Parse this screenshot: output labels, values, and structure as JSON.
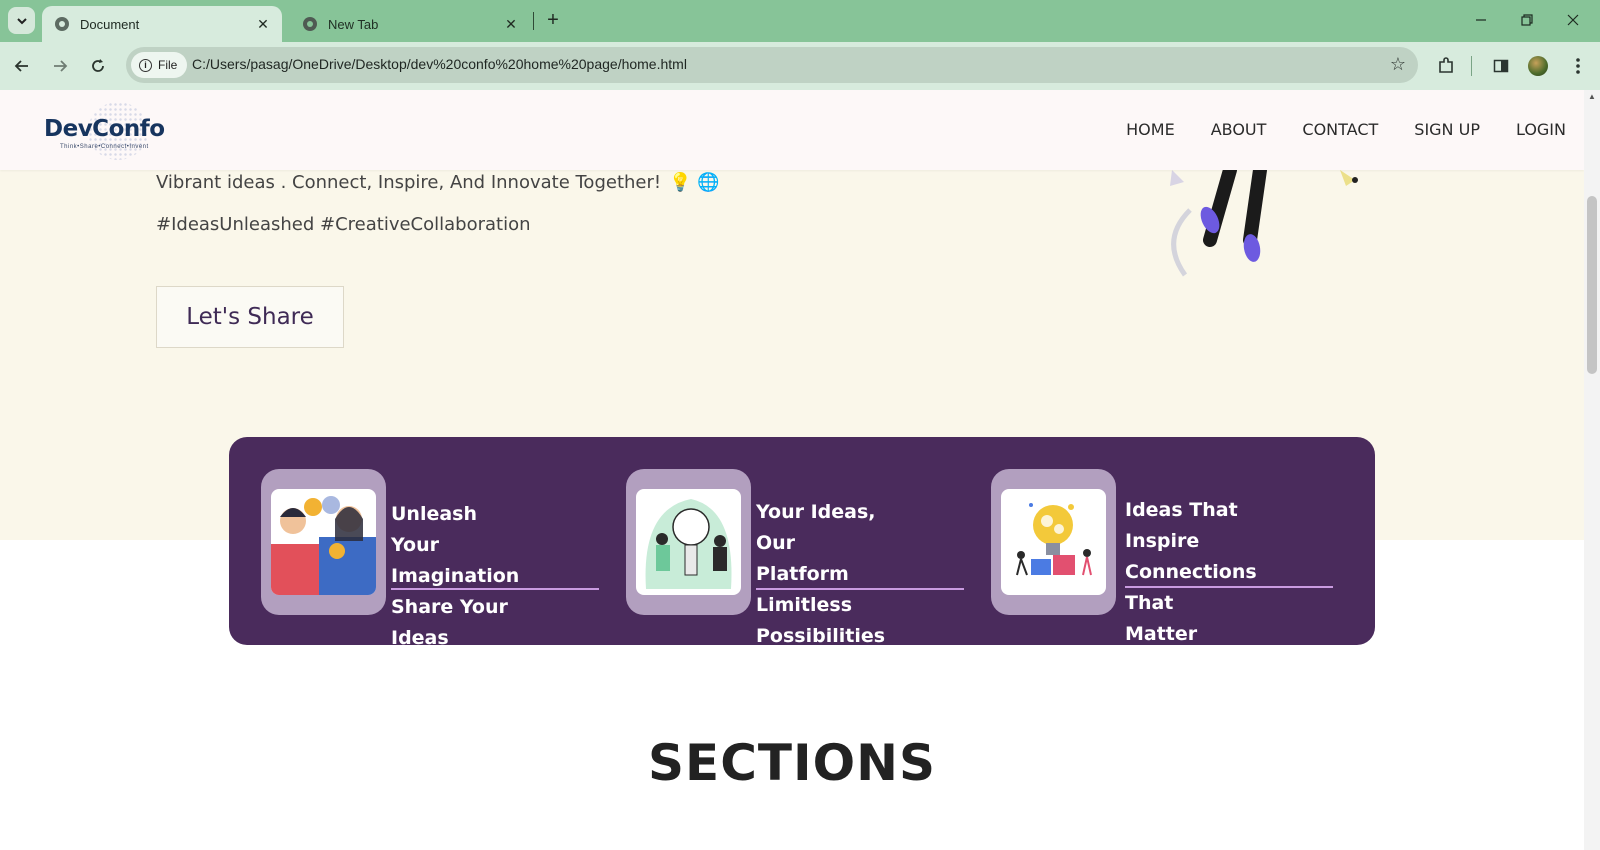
{
  "browser": {
    "tabs": [
      {
        "title": "Document",
        "active": true
      },
      {
        "title": "New Tab",
        "active": false
      }
    ],
    "address": {
      "scheme_label": "File",
      "url": "C:/Users/pasag/OneDrive/Desktop/dev%20confo%20home%20page/home.html"
    }
  },
  "site": {
    "logo": {
      "name": "DevConfo",
      "tagline": "Think•Share•Connect•Invent"
    },
    "nav": [
      "HOME",
      "ABOUT",
      "CONTACT",
      "SIGN UP",
      "LOGIN"
    ],
    "hero": {
      "line": "Vibrant ideas . Connect, Inspire, And Innovate Together!",
      "emojis": "💡 🌐",
      "hashtags": "#IdeasUnleashed #CreativeCollaboration",
      "cta": "Let's Share"
    },
    "features": [
      {
        "line1": "Unleash Your",
        "line2": "Imagination",
        "line3": "Share Your Ideas"
      },
      {
        "line1": "Your Ideas, Our",
        "line2": "Platform",
        "line3": "Limitless Possibilities"
      },
      {
        "line1": "Ideas That Inspire",
        "line2": "Connections That",
        "line3": "Matter"
      }
    ],
    "sections_heading": "SECTIONS"
  },
  "colors": {
    "tab_strip": "#87c498",
    "toolbar": "#d7ebdd",
    "hero_bg": "#faf7ea",
    "feature_band": "#4a2b5c",
    "feature_thumb": "#b29fbf",
    "underline_accent": "#c99be0",
    "logo_navy": "#17355f"
  }
}
